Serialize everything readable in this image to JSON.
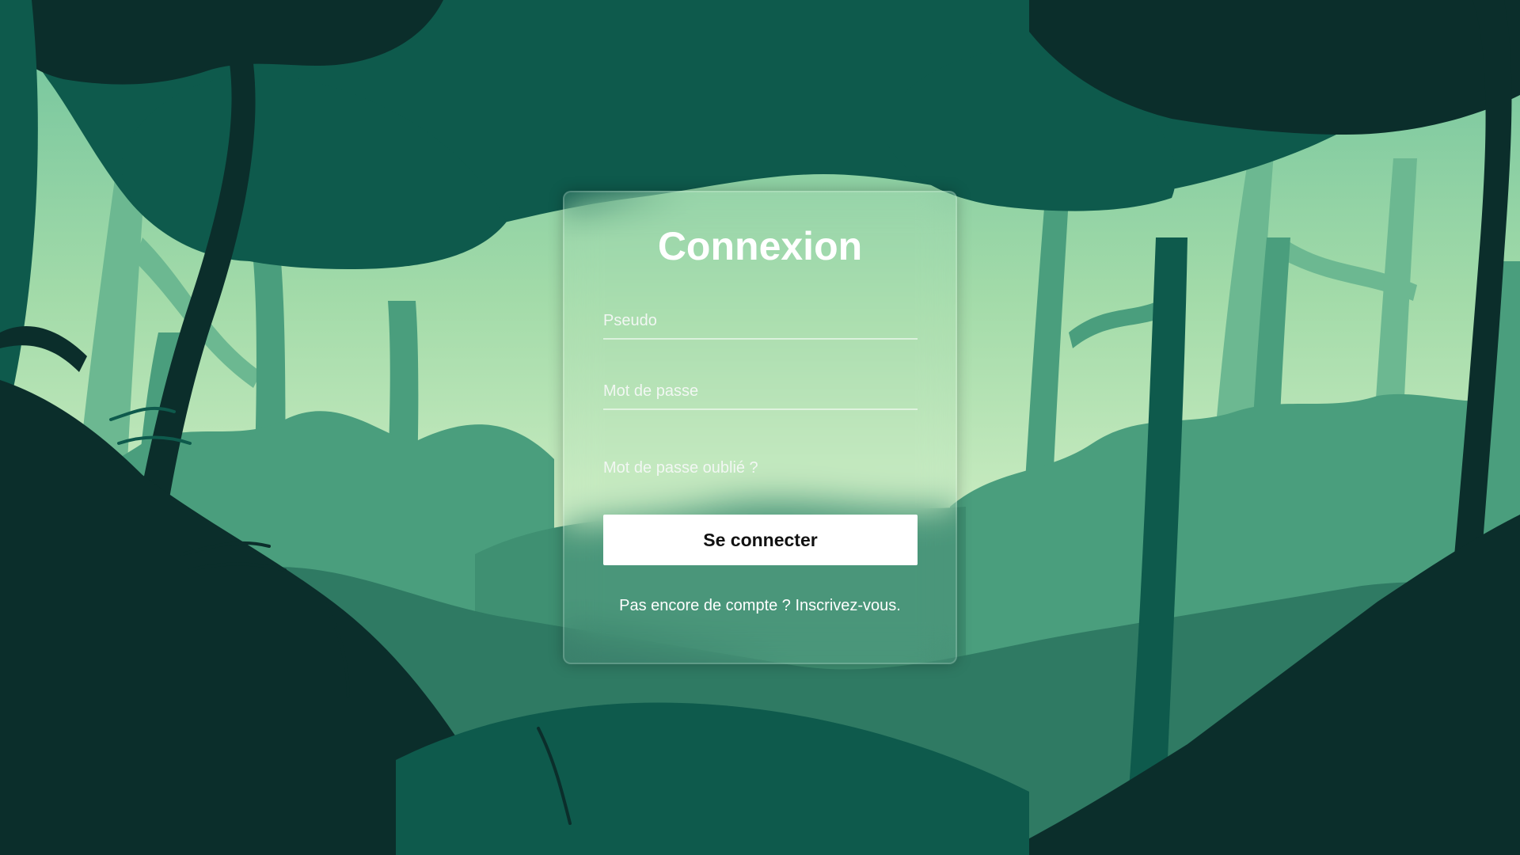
{
  "login": {
    "title": "Connexion",
    "username_placeholder": "Pseudo",
    "password_placeholder": "Mot de passe",
    "forgot_password": "Mot de passe oublié ?",
    "submit_label": "Se connecter",
    "signup_prompt": "Pas encore de compte ?",
    "signup_link": "Inscrivez-vous."
  },
  "colors": {
    "sky_light": "#c8ebc0",
    "forest_mid": "#4a9e7d",
    "forest_dark": "#0e5a4c",
    "forest_darkest": "#0b2e2b",
    "button_bg": "#ffffff",
    "text": "#ffffff"
  }
}
